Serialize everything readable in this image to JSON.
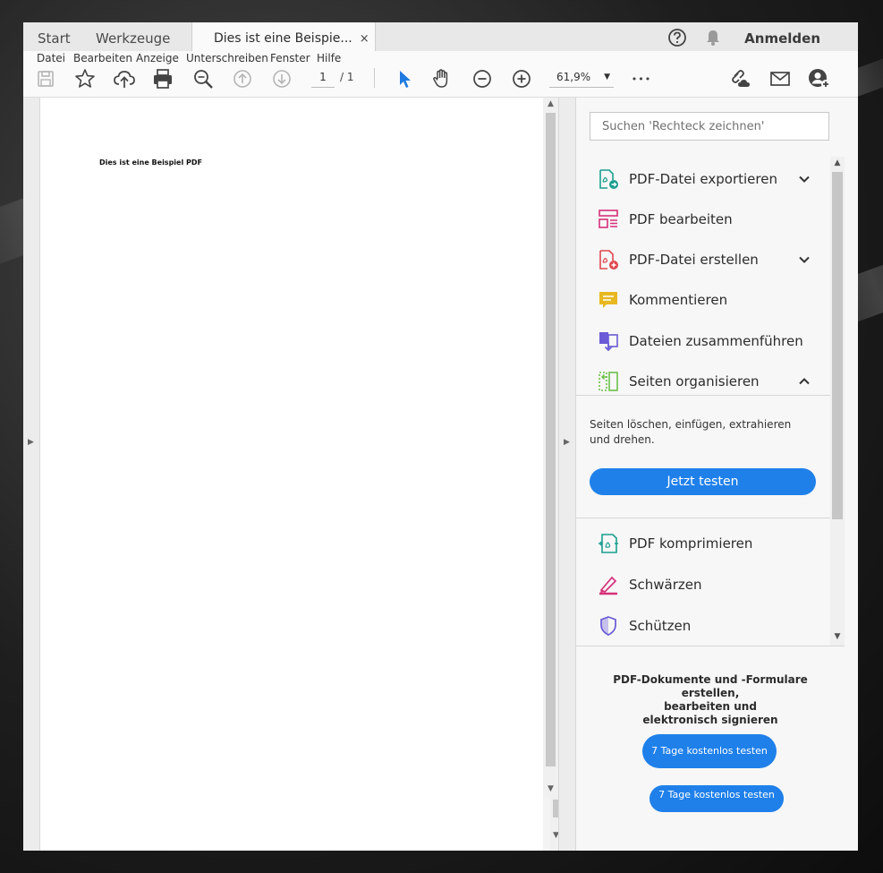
{
  "tabs": {
    "start": "Start",
    "tools": "Werkzeuge",
    "document": "Dies ist eine Beispie...",
    "close": "×"
  },
  "header": {
    "sign_in": "Anmelden"
  },
  "menu": [
    "Datei",
    "Bearbeiten",
    "Anzeige",
    "Unterschreiben",
    "Fenster",
    "Hilfe"
  ],
  "toolbar": {
    "page_current": "1",
    "page_total": "/ 1",
    "zoom": "61,9%",
    "more": "•••"
  },
  "document": {
    "text": "Dies ist eine Beispiel PDF"
  },
  "panel": {
    "search_placeholder": "Suchen 'Rechteck zeichnen'",
    "tools": [
      {
        "label": "PDF-Datei exportieren",
        "icon": "export-pdf-icon",
        "color": "#1a9e8f"
      },
      {
        "label": "PDF bearbeiten",
        "icon": "edit-pdf-icon",
        "color": "#d6307a"
      },
      {
        "label": "PDF-Datei erstellen",
        "icon": "create-pdf-icon",
        "color": "#e0484e"
      },
      {
        "label": "Kommentieren",
        "icon": "comment-icon",
        "color": "#e8b820"
      },
      {
        "label": "Dateien zusammenführen",
        "icon": "combine-files-icon",
        "color": "#6a5bd6"
      },
      {
        "label": "Seiten organisieren",
        "icon": "organize-pages-icon",
        "color": "#6cc04a"
      },
      {
        "label": "PDF komprimieren",
        "icon": "compress-pdf-icon",
        "color": "#1a9e8f"
      },
      {
        "label": "Schwärzen",
        "icon": "redact-icon",
        "color": "#d6307a"
      },
      {
        "label": "Schützen",
        "icon": "protect-icon",
        "color": "#6a5bd6"
      }
    ],
    "organize_desc": "Seiten löschen, einfügen, extrahieren und drehen.",
    "try_now": "Jetzt testen",
    "promo_text_1": "PDF-Dokumente und -Formulare erstellen,",
    "promo_text_2": "bearbeiten und",
    "promo_text_3": "elektronisch signieren",
    "promo_button": "7 Tage kostenlos testen",
    "promo_button_ghost": "7 Tage kostenlos testen"
  },
  "colors": {
    "accent": "#1f80ea",
    "select_tool": "#1f7ae0"
  }
}
